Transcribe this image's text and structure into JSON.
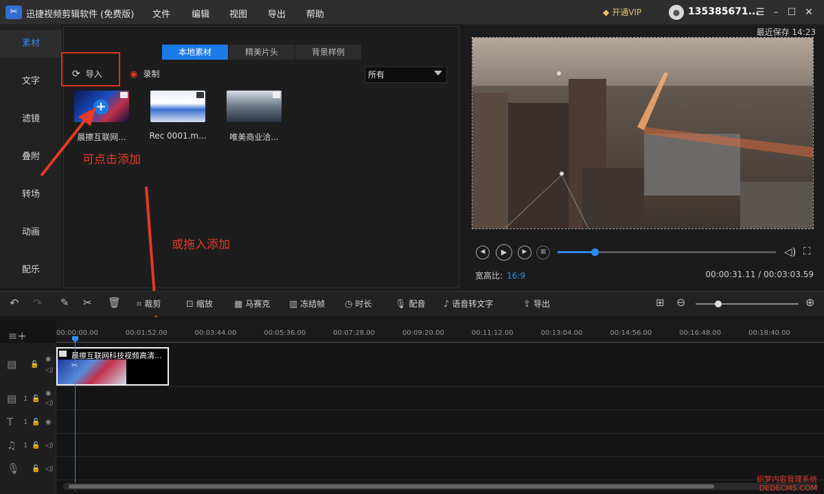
{
  "title_bar": {
    "app_title": "迅捷视频剪辑软件 (免费版)",
    "menus": [
      "文件",
      "编辑",
      "视图",
      "导出",
      "帮助"
    ],
    "vip_label": "开通VIP",
    "user": "135385671..."
  },
  "sidebar": {
    "items": [
      {
        "label": "素材"
      },
      {
        "label": "文字"
      },
      {
        "label": "滤镜"
      },
      {
        "label": "叠附"
      },
      {
        "label": "转场"
      },
      {
        "label": "动画"
      },
      {
        "label": "配乐"
      }
    ]
  },
  "library": {
    "tabs": [
      "本地素材",
      "精美片头",
      "背景样例"
    ],
    "import_label": "导入",
    "record_label": "录制",
    "filter_value": "所有",
    "media": [
      {
        "name": "晨擦互联网..."
      },
      {
        "name": "Rec 0001.m..."
      },
      {
        "name": "唯美商业洽..."
      }
    ]
  },
  "annotations": {
    "click_add": "可点击添加",
    "drag_add": "或拖入添加"
  },
  "preview": {
    "last_saved": "最近保存 14:23",
    "aspect_label": "宽高比:",
    "aspect_value": "16:9",
    "timecode": "00:00:31.11 / 00:03:03.59",
    "progress": 0.17
  },
  "toolbar": {
    "tools": [
      "裁剪",
      "缩放",
      "马赛克",
      "冻结帧",
      "时长",
      "配音",
      "语音转文字",
      "导出"
    ],
    "zoom": 0.22
  },
  "timeline": {
    "ticks": [
      "00:00:00.00",
      "00:01:52.00",
      "00:03:44.00",
      "00:05:36.00",
      "00:07:28.00",
      "00:09:20.00",
      "00:11:12.00",
      "00:13:04.00",
      "00:14:56.00",
      "00:16:48.00",
      "00:18:40.00"
    ],
    "clip_title": "晨擦互联网科技视频高清...",
    "track_numbers": [
      "1",
      "1",
      "1"
    ]
  },
  "watermark": {
    "line1": "织梦内容管理系统",
    "line2": "DEDECMS.COM"
  }
}
